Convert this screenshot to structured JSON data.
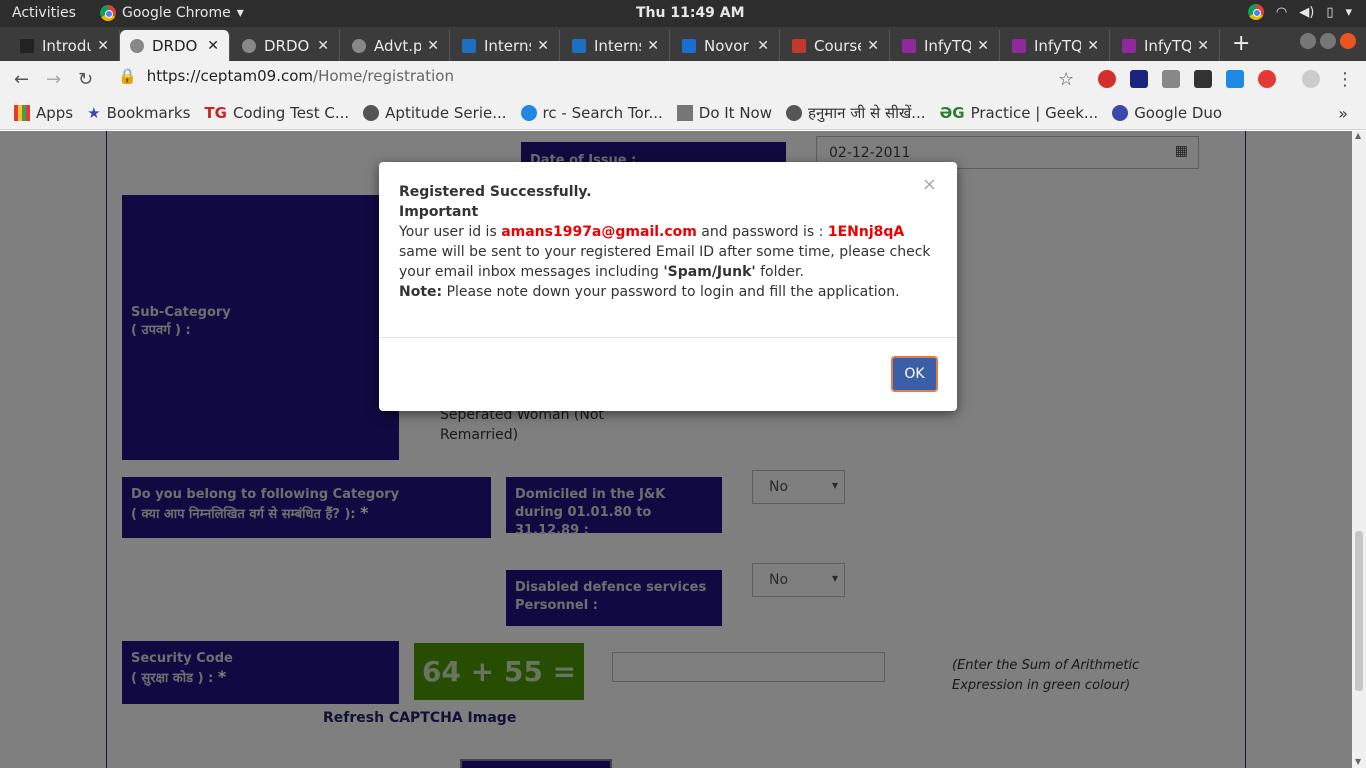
{
  "system": {
    "activities": "Activities",
    "app_name": "Google Chrome",
    "clock": "Thu 11:49 AM"
  },
  "tabs": [
    {
      "label": "Introdu",
      "color": "#222"
    },
    {
      "label": "DRDO",
      "color": "#888"
    },
    {
      "label": "DRDO",
      "color": "#888"
    },
    {
      "label": "Advt.p",
      "color": "#888"
    },
    {
      "label": "Interns",
      "color": "#1e6fbf"
    },
    {
      "label": "Interns",
      "color": "#1e6fbf"
    },
    {
      "label": "Novor",
      "color": "#1b6fd1"
    },
    {
      "label": "Course",
      "color": "#c0392b"
    },
    {
      "label": "InfyTQ",
      "color": "#8e2a9c"
    },
    {
      "label": "InfyTQ",
      "color": "#8e2a9c"
    },
    {
      "label": "InfyTQ",
      "color": "#8e2a9c"
    }
  ],
  "address": {
    "host": "https://ceptam09.com",
    "path": "/Home/registration"
  },
  "bookmarks": [
    {
      "label": "Apps",
      "color": "#e53935"
    },
    {
      "label": "Bookmarks",
      "color": "#3949ab"
    },
    {
      "label": "Coding Test C...",
      "color": "#c62828"
    },
    {
      "label": "Aptitude Serie...",
      "color": "#555"
    },
    {
      "label": "rc - Search Tor...",
      "color": "#1e88e5"
    },
    {
      "label": "Do It Now",
      "color": "#777"
    },
    {
      "label": "हनुमान जी से सीखें...",
      "color": "#555"
    },
    {
      "label": "Practice | Geek...",
      "color": "#2e7d32"
    },
    {
      "label": "Google Duo",
      "color": "#3949ab"
    }
  ],
  "form": {
    "date_label": "Date of Issue :",
    "date_value": "02-12-2011",
    "subcategory_label": "Sub-Category",
    "subcategory_hindi": "( उपवर्ग ) :",
    "option_text_1": "Seperated Woman (Not",
    "option_text_2": "Remarried)",
    "category_q": "Do you belong to following Category",
    "category_q_hindi": "( क्या आप निम्नलिखित वर्ग से सम्बंधित हैं? ):",
    "domiciled_label": "Domiciled in the J&K during 01.01.80 to 31.12.89 :",
    "domiciled_value": "No",
    "disabled_label": "Disabled defence services Personnel :",
    "disabled_value": "No",
    "security_label": "Security Code",
    "security_hindi": "( सुरक्षा कोड ) :",
    "captcha": "64 + 55 =",
    "captcha_hint": "(Enter the Sum of Arithmetic Expression in green colour)",
    "refresh": "Refresh CAPTCHA Image",
    "required_mark": "*"
  },
  "modal": {
    "title": "Registered Successfully.",
    "important": "Important",
    "userid_prefix": "Your user id is ",
    "userid": "amans1997a@gmail.com",
    "password_prefix": " and password is : ",
    "password": "1ENnj8qA",
    "line2_a": "same will be sent to your registered Email ID after some time, please check your email inbox messages including ",
    "line2_b": "'Spam/Junk'",
    "line2_c": " folder.",
    "note_label": "Note:",
    "note_text": " Please note down your password to login and fill the application.",
    "close": "×",
    "ok": "OK"
  }
}
